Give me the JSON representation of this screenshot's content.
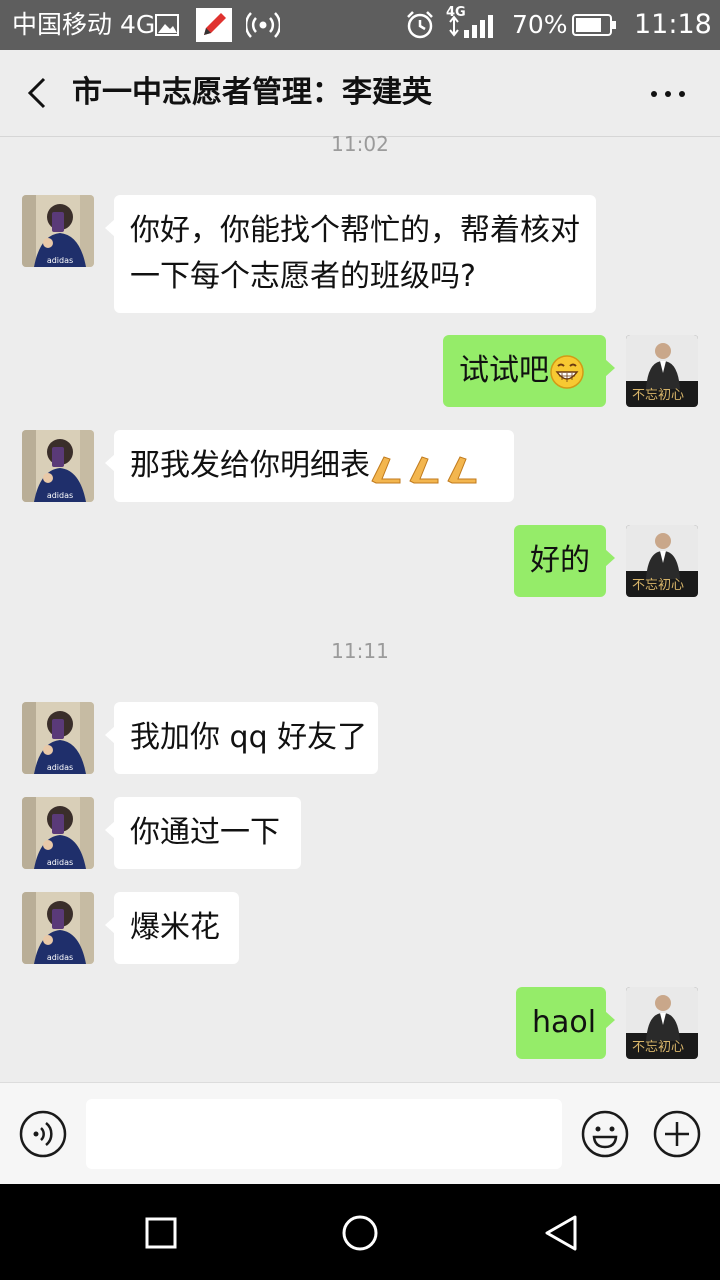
{
  "status": {
    "carrier": "中国移动 4G",
    "battery": "70%",
    "time": "11:18",
    "net": "4G"
  },
  "header": {
    "title": "市一中志愿者管理：李建英"
  },
  "chat": {
    "timestamps": [
      "11:02",
      "11:11"
    ],
    "messages": [
      {
        "side": "left",
        "lines": [
          "你好，你能找个帮忙的，帮着核对",
          "一下每个志愿者的班级吗?"
        ]
      },
      {
        "side": "right",
        "text": "试试吧",
        "emoji": "grin"
      },
      {
        "side": "left",
        "text": "那我发给你明细表",
        "emoji": "clap-x3"
      },
      {
        "side": "right",
        "text": "好的"
      },
      {
        "side": "left",
        "text": "我加你 qq 好友了"
      },
      {
        "side": "left",
        "text": "你通过一下"
      },
      {
        "side": "left",
        "text": "爆米花"
      },
      {
        "side": "right",
        "text": "haol"
      }
    ]
  },
  "input": {
    "voice_icon": "voice-icon",
    "emoji_icon": "emoji-icon",
    "plus_icon": "plus-icon"
  },
  "colors": {
    "self_bubble": "#95ec69",
    "other_bubble": "#ffffff",
    "background": "#ededed"
  }
}
